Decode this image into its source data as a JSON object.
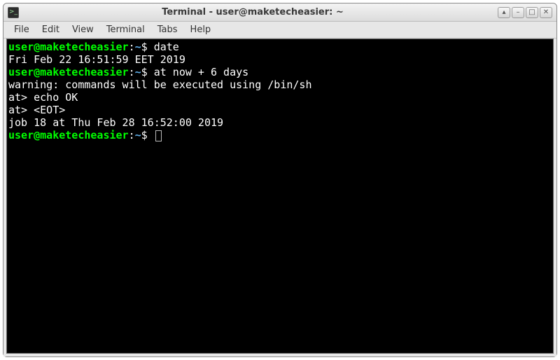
{
  "window": {
    "title": "Terminal - user@maketecheasier: ~"
  },
  "menu": {
    "file": "File",
    "edit": "Edit",
    "view": "View",
    "terminal": "Terminal",
    "tabs": "Tabs",
    "help": "Help"
  },
  "prompt": {
    "user_host": "user@maketecheasier",
    "sep": ":",
    "path": "~",
    "sym": "$"
  },
  "lines": {
    "cmd1": "date",
    "out1": "Fri Feb 22 16:51:59 EET 2019",
    "cmd2": "at now + 6 days",
    "out2": "warning: commands will be executed using /bin/sh",
    "out3": "at> echo OK",
    "out4": "at> <EOT>",
    "out5": "job 18 at Thu Feb 28 16:52:00 2019"
  },
  "winbtn": {
    "up": "▴",
    "min": "–",
    "max": "□",
    "close": "✕"
  }
}
